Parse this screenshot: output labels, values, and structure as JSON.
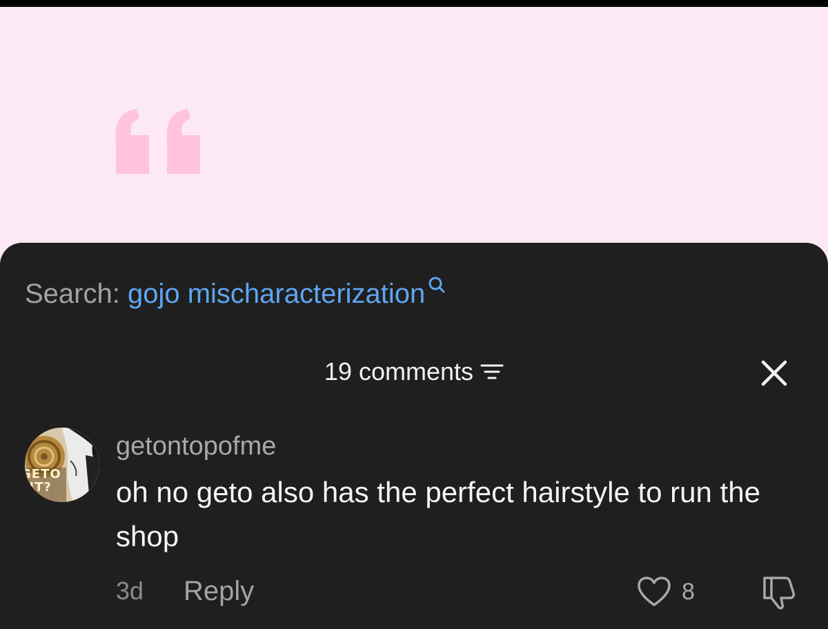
{
  "post": {
    "quote_color": "#ffc3de",
    "background_color": "#fde9f4"
  },
  "search": {
    "prefix": "Search:",
    "query": "gojo mischaracterization",
    "icon": "search-icon"
  },
  "comments": {
    "count_label": "19 comments",
    "sort_icon": "filter-icon",
    "close_icon": "close-icon",
    "items": [
      {
        "username": "getontopofme",
        "avatar_text": [
          "GETO",
          "HT?"
        ],
        "text": "oh no geto also has the perfect hairstyle to run the shop",
        "time": "3d",
        "reply_label": "Reply",
        "likes": "8",
        "like_icon": "heart-icon",
        "dislike_icon": "thumbs-down-icon"
      }
    ]
  },
  "colors": {
    "sheet": "#1f1f1f",
    "link": "#5ea6f2",
    "muted": "#a3a3a3"
  }
}
